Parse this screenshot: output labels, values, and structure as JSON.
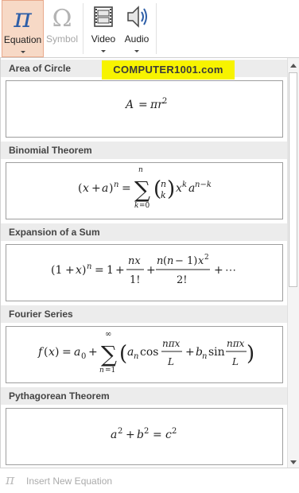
{
  "ribbon": {
    "equation_label": "Equation",
    "symbol_label": "Symbol",
    "video_label": "Video",
    "audio_label": "Audio"
  },
  "watermark": "COMPUTER1001.com",
  "sections": [
    {
      "title": "Area of Circle"
    },
    {
      "title": "Binomial Theorem"
    },
    {
      "title": "Expansion of a Sum"
    },
    {
      "title": "Fourier Series"
    },
    {
      "title": "Pythagorean Theorem"
    }
  ],
  "footer": {
    "insert_label": "Insert New Equation"
  },
  "colors": {
    "active_bg": "#f7d9c6",
    "accent_blue": "#2b579a",
    "watermark_bg": "#f7f300"
  }
}
